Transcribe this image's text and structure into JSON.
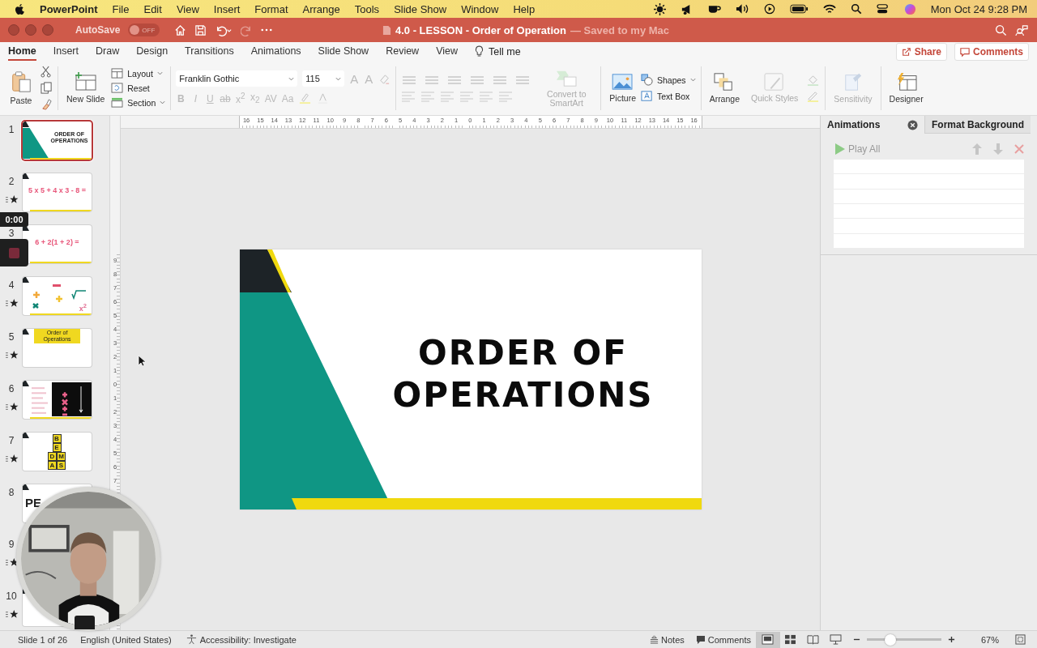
{
  "menu_bar": {
    "app": "PowerPoint",
    "items": [
      "File",
      "Edit",
      "View",
      "Insert",
      "Format",
      "Arrange",
      "Tools",
      "Slide Show",
      "Window",
      "Help"
    ],
    "clock": "Mon Oct 24  9:28 PM"
  },
  "title_bar": {
    "autosave_label": "AutoSave",
    "autosave": {
      "on": false,
      "label": "OFF"
    },
    "document": "4.0 - LESSON - Order of Operation",
    "save_status": "— Saved to my Mac"
  },
  "ribbon_tabs": [
    {
      "label": "Home",
      "selected": true
    },
    {
      "label": "Insert",
      "selected": false
    },
    {
      "label": "Draw",
      "selected": false
    },
    {
      "label": "Design",
      "selected": false
    },
    {
      "label": "Transitions",
      "selected": false
    },
    {
      "label": "Animations",
      "selected": false
    },
    {
      "label": "Slide Show",
      "selected": false
    },
    {
      "label": "Review",
      "selected": false
    },
    {
      "label": "View",
      "selected": false
    }
  ],
  "tell_me": "Tell me",
  "share": "Share",
  "comments_button": "Comments",
  "ribbon": {
    "paste": "Paste",
    "new_slide": "New Slide",
    "layout": "Layout",
    "reset": "Reset",
    "section": "Section",
    "font": {
      "value": "Franklin Gothic"
    },
    "size": {
      "value": "115"
    },
    "size_buttons": [
      "A",
      "A"
    ],
    "format_buttons": [
      "B",
      "I",
      "U",
      "ab",
      "x$^{2}$",
      "x$_{2}$",
      "AV",
      "Aa"
    ],
    "convert": {
      "label": "Convert to SmartArt",
      "disabled": true
    },
    "picture": "Picture",
    "shapes": "Shapes",
    "text_box": "Text Box",
    "arrange": "Arrange",
    "quick_styles": {
      "label": "Quick Styles",
      "disabled": true
    },
    "sensitivity": {
      "label": "Sensitivity",
      "disabled": true
    },
    "designer": "Designer"
  },
  "thumbnails": [
    {
      "number": "1",
      "selected": true,
      "animated": false,
      "kind": "title",
      "title": "ORDER OF OPERATIONS"
    },
    {
      "number": "2",
      "selected": false,
      "animated": true,
      "kind": "equation",
      "equation": "5 x 5 + 4 x 3 - 8 ="
    },
    {
      "number": "3",
      "selected": false,
      "kind": "equation",
      "equation": "6 + 2(1 + 2) ="
    },
    {
      "number": "4",
      "selected": false,
      "animated": true,
      "kind": "operations",
      "symbol": "x$^{2}$"
    },
    {
      "number": "5",
      "selected": false,
      "animated": true,
      "kind": "definition",
      "heading": "Order of Operations"
    },
    {
      "number": "6",
      "selected": false,
      "animated": true,
      "kind": "chart"
    },
    {
      "number": "7",
      "selected": false,
      "animated": true,
      "kind": "letters",
      "letters": [
        "B",
        "E",
        "D",
        "M",
        "A",
        "S"
      ]
    },
    {
      "number": "8",
      "selected": false,
      "animated": false,
      "kind": "big_text",
      "text": "PE"
    },
    {
      "number": "9",
      "animated": true,
      "kind": "hidden"
    },
    {
      "number": "10",
      "selected": false,
      "animated": true,
      "kind": "blank"
    }
  ],
  "recording": {
    "time": "0:00"
  },
  "ruler_h": [
    "16",
    "15",
    "14",
    "13",
    "12",
    "11",
    "10",
    "9",
    "8",
    "7",
    "6",
    "5",
    "4",
    "3",
    "2",
    "1",
    "0",
    "1",
    "2",
    "3",
    "4",
    "5",
    "6",
    "7",
    "8",
    "9",
    "10",
    "11",
    "12",
    "13",
    "14",
    "15",
    "16"
  ],
  "ruler_v": [
    "9",
    "8",
    "7",
    "6",
    "5",
    "4",
    "3",
    "2",
    "1",
    "0",
    "1",
    "2",
    "3",
    "4",
    "5",
    "6",
    "7"
  ],
  "slide": {
    "title_lines": [
      "ORDER OF",
      "OPERATIONS"
    ]
  },
  "pane": {
    "tabs": [
      {
        "label": "Animations",
        "selected": true
      },
      {
        "label": "Format Background",
        "selected": false
      }
    ],
    "play_all": "Play All"
  },
  "status_bar": {
    "slide_info": "Slide 1 of 26",
    "language": "English (United States)",
    "accessibility": "Accessibility: Investigate",
    "notes": "Notes",
    "comments": "Comments",
    "views": [
      {
        "kind": "normal",
        "selected": true
      },
      {
        "kind": "sorter",
        "selected": false
      },
      {
        "kind": "reading",
        "selected": false
      },
      {
        "kind": "slideshow",
        "selected": false
      }
    ],
    "zoom": {
      "level": 0.32,
      "value": "67%"
    }
  }
}
